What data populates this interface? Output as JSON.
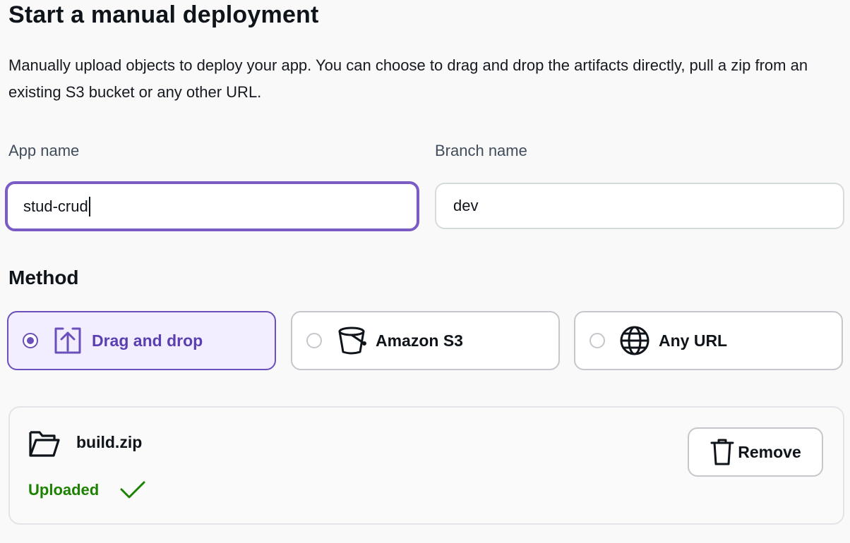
{
  "header": {
    "title": "Start a manual deployment",
    "description": "Manually upload objects to deploy your app. You can choose to drag and drop the artifacts directly, pull a zip from an existing S3 bucket or any other URL."
  },
  "form": {
    "app_name": {
      "label": "App name",
      "value": "stud-crud"
    },
    "branch_name": {
      "label": "Branch name",
      "value": "dev"
    }
  },
  "method": {
    "heading": "Method",
    "options": [
      {
        "label": "Drag and drop",
        "icon": "upload-icon",
        "selected": true
      },
      {
        "label": "Amazon S3",
        "icon": "bucket-icon",
        "selected": false
      },
      {
        "label": "Any URL",
        "icon": "globe-icon",
        "selected": false
      }
    ]
  },
  "upload": {
    "file_name": "build.zip",
    "file_icon": "folder-icon",
    "status": "Uploaded",
    "status_icon": "checkmark-icon",
    "remove_label": "Remove",
    "remove_icon": "trash-icon"
  },
  "colors": {
    "accent": "#6b4fbb",
    "success": "#1d8102",
    "selected_bg": "#f2eeff"
  }
}
